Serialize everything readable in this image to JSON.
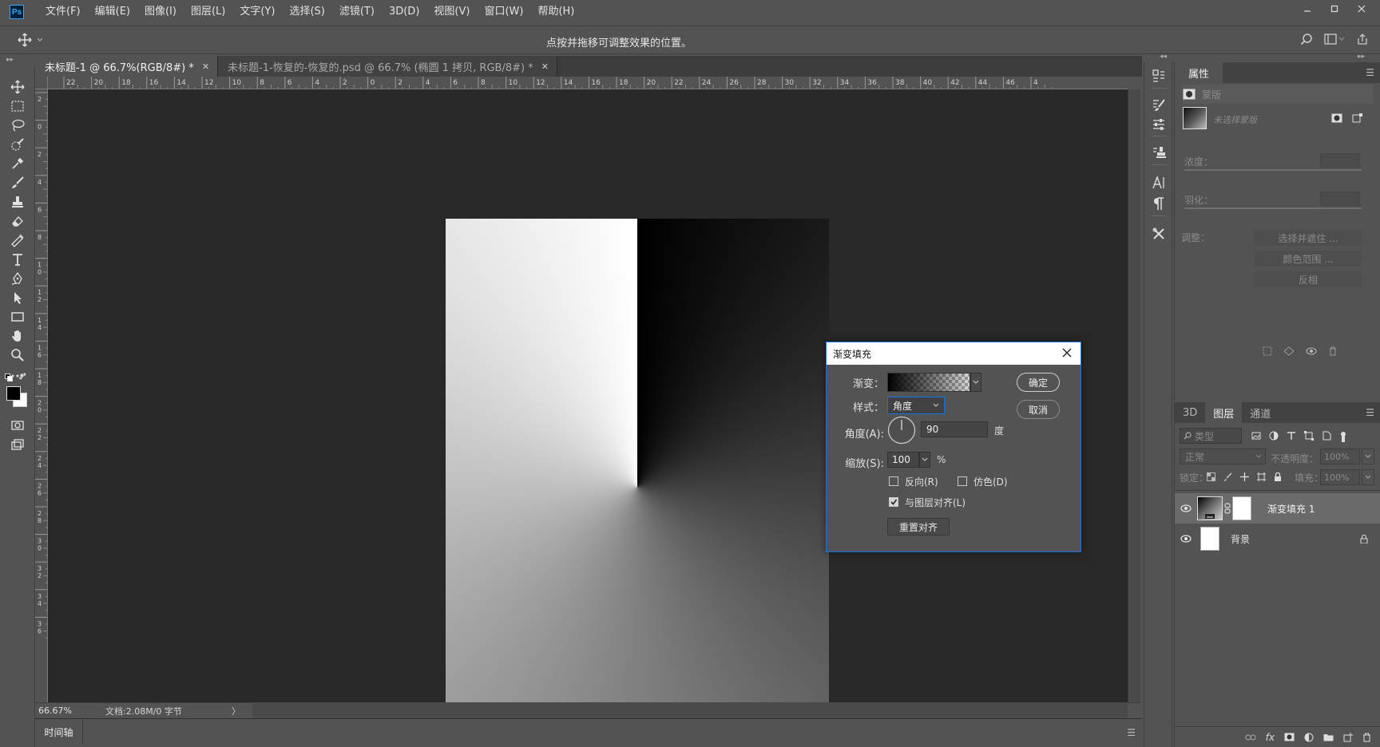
{
  "app": {
    "logo": "Ps",
    "menu": [
      "文件(F)",
      "编辑(E)",
      "图像(I)",
      "图层(L)",
      "文字(Y)",
      "选择(S)",
      "滤镜(T)",
      "3D(D)",
      "视图(V)",
      "窗口(W)",
      "帮助(H)"
    ],
    "window_controls": [
      "minimize-icon",
      "restore-icon",
      "close-icon"
    ]
  },
  "options_bar": {
    "tool_icon": "move-tool-icon",
    "hint": "点按并拖移可调整效果的位置。",
    "right_icons": [
      "search-icon",
      "workspace-icon",
      "share-icon"
    ]
  },
  "tools": [
    "move-tool-icon",
    "rectangular-marquee-icon",
    "lasso-icon",
    "quick-selection-icon",
    "eyedropper-icon",
    "brush-icon",
    "clone-stamp-icon",
    "eraser-icon",
    "gradient-icon",
    "type-tool-icon",
    "pen-icon",
    "path-selection-icon",
    "rectangle-icon",
    "hand-icon",
    "zoom-icon",
    "more-tools-icon"
  ],
  "colors": {
    "foreground": "#000000",
    "background": "#ffffff",
    "accent": "#1473e6",
    "ui_bg": "#535353",
    "canvas_bg": "#282828"
  },
  "tabs": [
    {
      "label": "未标题-1 @ 66.7%(RGB/8#) *",
      "active": true
    },
    {
      "label": "未标题-1-恢复的-恢复的.psd @ 66.7% (椭圆 1 拷贝, RGB/8#) *",
      "active": false
    }
  ],
  "rulers": {
    "top": [
      "22",
      "20",
      "18",
      "16",
      "14",
      "12",
      "10",
      "8",
      "6",
      "4",
      "2",
      "0",
      "2",
      "4",
      "6",
      "8",
      "10",
      "12",
      "14",
      "16",
      "18",
      "20",
      "22",
      "24",
      "26",
      "28",
      "30",
      "32",
      "34",
      "36",
      "38",
      "40",
      "42",
      "44",
      "46",
      "4"
    ],
    "left": [
      "2",
      "0",
      "2",
      "4",
      "6",
      "8",
      "10",
      "12",
      "14",
      "16",
      "18",
      "20",
      "22",
      "24",
      "26",
      "28",
      "30",
      "32",
      "34",
      "36"
    ]
  },
  "status": {
    "zoom": "66.67%",
    "doc_info": "文档:2.08M/0 字节",
    "arrow": "〉"
  },
  "timeline": {
    "label": "时间轴"
  },
  "properties": {
    "title": "属性",
    "mask_type": "蒙版",
    "no_mask": "未选择蒙版",
    "density_label": "浓度：",
    "feather_label": "羽化：",
    "adjust_label": "调整：",
    "btn_select_mask": "选择并遮住 ...",
    "btn_color_range": "颜色范围 ...",
    "btn_invert": "反相"
  },
  "layers_panel": {
    "tabs": [
      "3D",
      "图层",
      "通道"
    ],
    "active_tab": "图层",
    "filter_placeholder": "类型",
    "blend_mode": "正常",
    "opacity_label": "不透明度：",
    "opacity": "100%",
    "lock_label": "锁定：",
    "fill_label": "填充：",
    "fill": "100%",
    "layers": [
      {
        "name": "渐变填充 1",
        "selected": true,
        "locked": false
      },
      {
        "name": "背景",
        "selected": false,
        "locked": true
      }
    ]
  },
  "dialog": {
    "title": "渐变填充",
    "gradient_label": "渐变：",
    "style_label": "样式：",
    "style_value": "角度",
    "angle_label": "角度(A):",
    "angle_value": "90",
    "angle_unit": "度",
    "scale_label": "缩放(S):",
    "scale_value": "100",
    "scale_unit": "%",
    "reverse_label": "反向(R)",
    "reverse_checked": false,
    "dither_label": "仿色(D)",
    "dither_checked": false,
    "align_label": "与图层对齐(L)",
    "align_checked": true,
    "reset_btn": "重置对齐",
    "ok_btn": "确定",
    "cancel_btn": "取消"
  }
}
